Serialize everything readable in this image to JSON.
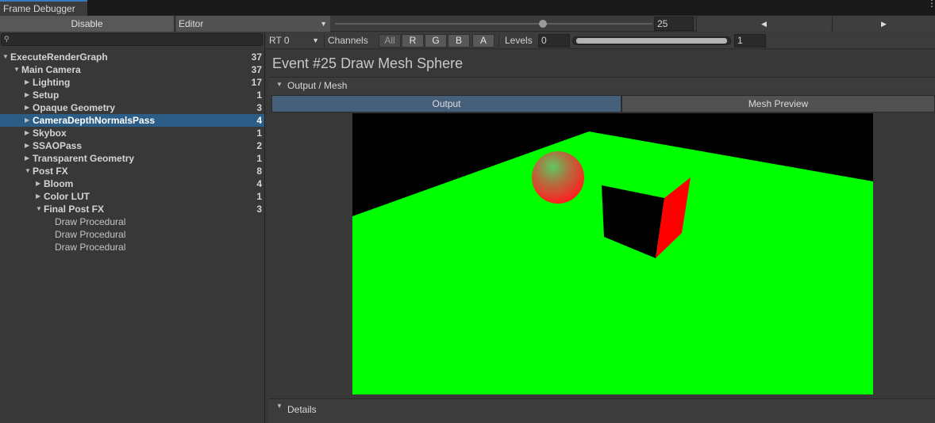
{
  "window": {
    "tab_title": "Frame Debugger",
    "menu_icon": "kebab-menu-icon"
  },
  "toolbar": {
    "disable_label": "Disable",
    "target_dropdown": "Editor",
    "event_index": "25",
    "event_slider_fraction": 0.655,
    "prev_icon": "◀",
    "next_icon": "▶"
  },
  "search": {
    "placeholder": "",
    "icon": "search-icon"
  },
  "tree": [
    {
      "label": "ExecuteRenderGraph",
      "count": "37",
      "depth": 0,
      "expanded": true
    },
    {
      "label": "Main Camera",
      "count": "37",
      "depth": 1,
      "expanded": true
    },
    {
      "label": "Lighting",
      "count": "17",
      "depth": 2,
      "expanded": false
    },
    {
      "label": "Setup",
      "count": "1",
      "depth": 2,
      "expanded": false
    },
    {
      "label": "Opaque Geometry",
      "count": "3",
      "depth": 2,
      "expanded": false
    },
    {
      "label": "CameraDepthNormalsPass",
      "count": "4",
      "depth": 2,
      "expanded": false,
      "selected": true
    },
    {
      "label": "Skybox",
      "count": "1",
      "depth": 2,
      "expanded": false
    },
    {
      "label": "SSAOPass",
      "count": "2",
      "depth": 2,
      "expanded": false
    },
    {
      "label": "Transparent Geometry",
      "count": "1",
      "depth": 2,
      "expanded": false
    },
    {
      "label": "Post FX",
      "count": "8",
      "depth": 2,
      "expanded": true
    },
    {
      "label": "Bloom",
      "count": "4",
      "depth": 3,
      "expanded": false
    },
    {
      "label": "Color LUT",
      "count": "1",
      "depth": 3,
      "expanded": false
    },
    {
      "label": "Final Post FX",
      "count": "3",
      "depth": 3,
      "expanded": true
    },
    {
      "label": "Draw Procedural",
      "count": "",
      "depth": 4,
      "leaf": true
    },
    {
      "label": "Draw Procedural",
      "count": "",
      "depth": 4,
      "leaf": true
    },
    {
      "label": "Draw Procedural",
      "count": "",
      "depth": 4,
      "leaf": true
    }
  ],
  "render_target": {
    "label": "RT 0"
  },
  "channels": {
    "label": "Channels",
    "options": [
      "All",
      "R",
      "G",
      "B",
      "A"
    ]
  },
  "levels": {
    "label": "Levels",
    "min": "0",
    "max": "1"
  },
  "event": {
    "title": "Event #25 Draw Mesh Sphere"
  },
  "output_panel": {
    "header": "Output / Mesh",
    "tabs": [
      "Output",
      "Mesh Preview"
    ],
    "active_tab": "Output"
  },
  "details": {
    "header": "Details"
  },
  "colors": {
    "selection": "#2c5d87",
    "active_tab": "#46607c",
    "ground": "#00ff00",
    "cube_side": "#ff0000"
  }
}
